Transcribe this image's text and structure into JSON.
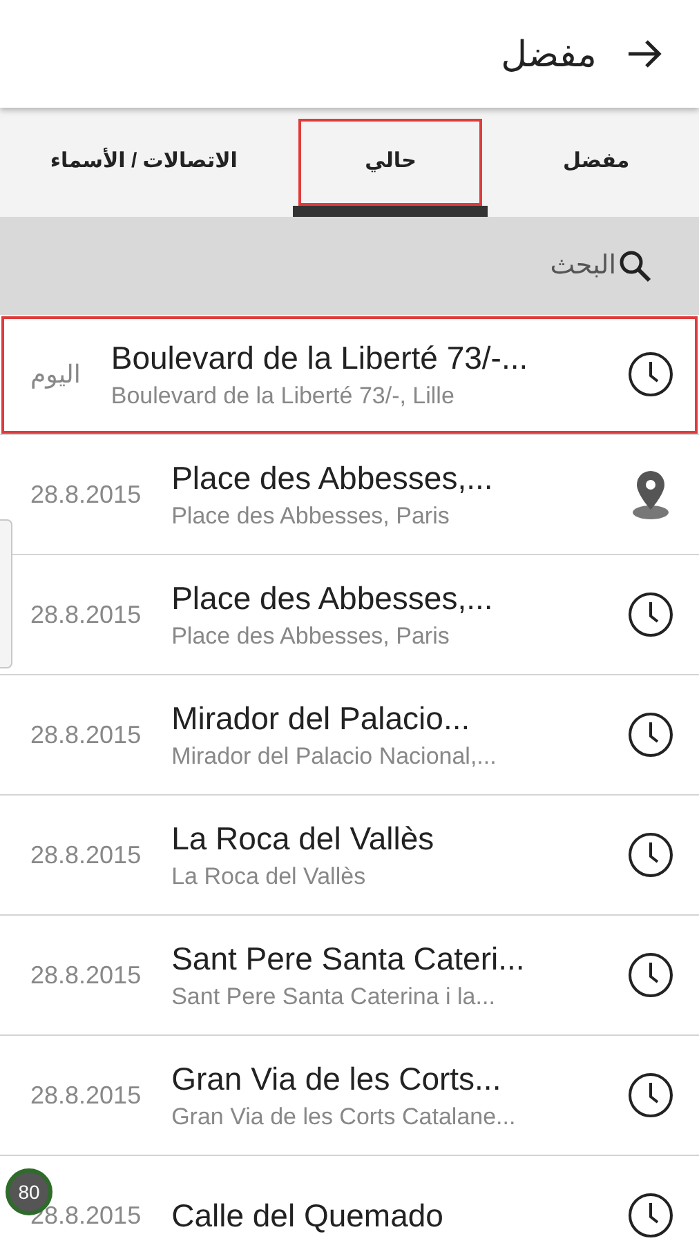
{
  "header": {
    "title": "مفضل"
  },
  "tabs": [
    {
      "label": "مفضل",
      "selected": false,
      "highlighted": false
    },
    {
      "label": "حالي",
      "selected": true,
      "highlighted": true
    },
    {
      "label": "الاتصالات / الأسماء",
      "selected": false,
      "highlighted": false
    }
  ],
  "search": {
    "placeholder": "البحث"
  },
  "places": [
    {
      "date": "اليوم",
      "title": "Boulevard de la Liberté 73/-...",
      "subtitle": "Boulevard de la Liberté 73/-, Lille",
      "kind": "recent",
      "highlighted": true
    },
    {
      "date": "28.8.2015",
      "title": "Place des Abbesses,...",
      "subtitle": "Place des Abbesses, Paris",
      "kind": "pin",
      "highlighted": false
    },
    {
      "date": "28.8.2015",
      "title": "Place des Abbesses,...",
      "subtitle": "Place des Abbesses, Paris",
      "kind": "recent",
      "highlighted": false
    },
    {
      "date": "28.8.2015",
      "title": "Mirador del Palacio...",
      "subtitle": "Mirador del Palacio Nacional,...",
      "kind": "recent",
      "highlighted": false
    },
    {
      "date": "28.8.2015",
      "title": "La Roca del Vallès",
      "subtitle": "La Roca del Vallès",
      "kind": "recent",
      "highlighted": false
    },
    {
      "date": "28.8.2015",
      "title": "Sant Pere Santa Cateri...",
      "subtitle": "Sant Pere Santa Caterina i la...",
      "kind": "recent",
      "highlighted": false
    },
    {
      "date": "28.8.2015",
      "title": "Gran Via de les Corts...",
      "subtitle": "Gran Via de les Corts Catalane...",
      "kind": "recent",
      "highlighted": false
    },
    {
      "date": "28.8.2015",
      "title": "Calle del Quemado",
      "kind": "recent",
      "highlighted": false
    }
  ],
  "badge": "80"
}
